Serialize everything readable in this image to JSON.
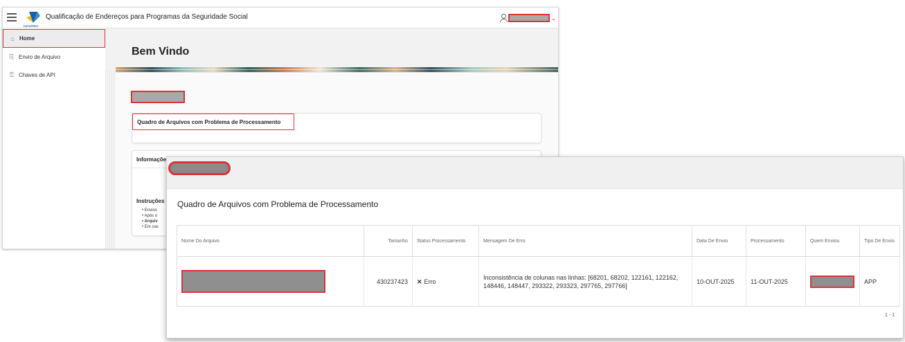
{
  "app": {
    "title": "Qualificação de Endereços para Programas da Seguridade Social",
    "logo_text": "DATAPREV"
  },
  "sidebar": {
    "items": [
      {
        "label": "Home",
        "icon": "home-icon"
      },
      {
        "label": "Envio de Arquivo",
        "icon": "upload-icon"
      },
      {
        "label": "Chaves de API",
        "icon": "key-icon"
      }
    ]
  },
  "main": {
    "heading": "Bem Vindo",
    "card_problems_title": "Quadro de Arquivos com Problema de Processamento",
    "card_info_title": "Informações",
    "instructions_title": "Instruções",
    "instructions_bullets": [
      "Envios",
      "Após o",
      "Arquiv",
      "Em cas"
    ]
  },
  "detail": {
    "title": "Quadro de Arquivos com Problema de Processamento",
    "columns": [
      "Nome Do Arquivo",
      "Tamanho",
      "Status Processamento",
      "Mensagem De Erro",
      "Data De Envio",
      "Processamento",
      "Quem Enviou",
      "Tipo De Envio"
    ],
    "rows": [
      {
        "nome": "",
        "tamanho": "430237423",
        "status": "Erro",
        "mensagem": "Inconsistência de colunas nas linhas: [68201, 68202, 122161, 122162, 148446, 148447, 293322, 293323, 297765, 297766]",
        "data_envio": "10-OUT-2025",
        "processamento": "11-OUT-2025",
        "quem_enviou": "",
        "tipo_envio": "APP"
      }
    ],
    "pagination": "1 - 1"
  },
  "colors": {
    "highlight": "#d9323b",
    "redaction": "#9a9a9a"
  }
}
